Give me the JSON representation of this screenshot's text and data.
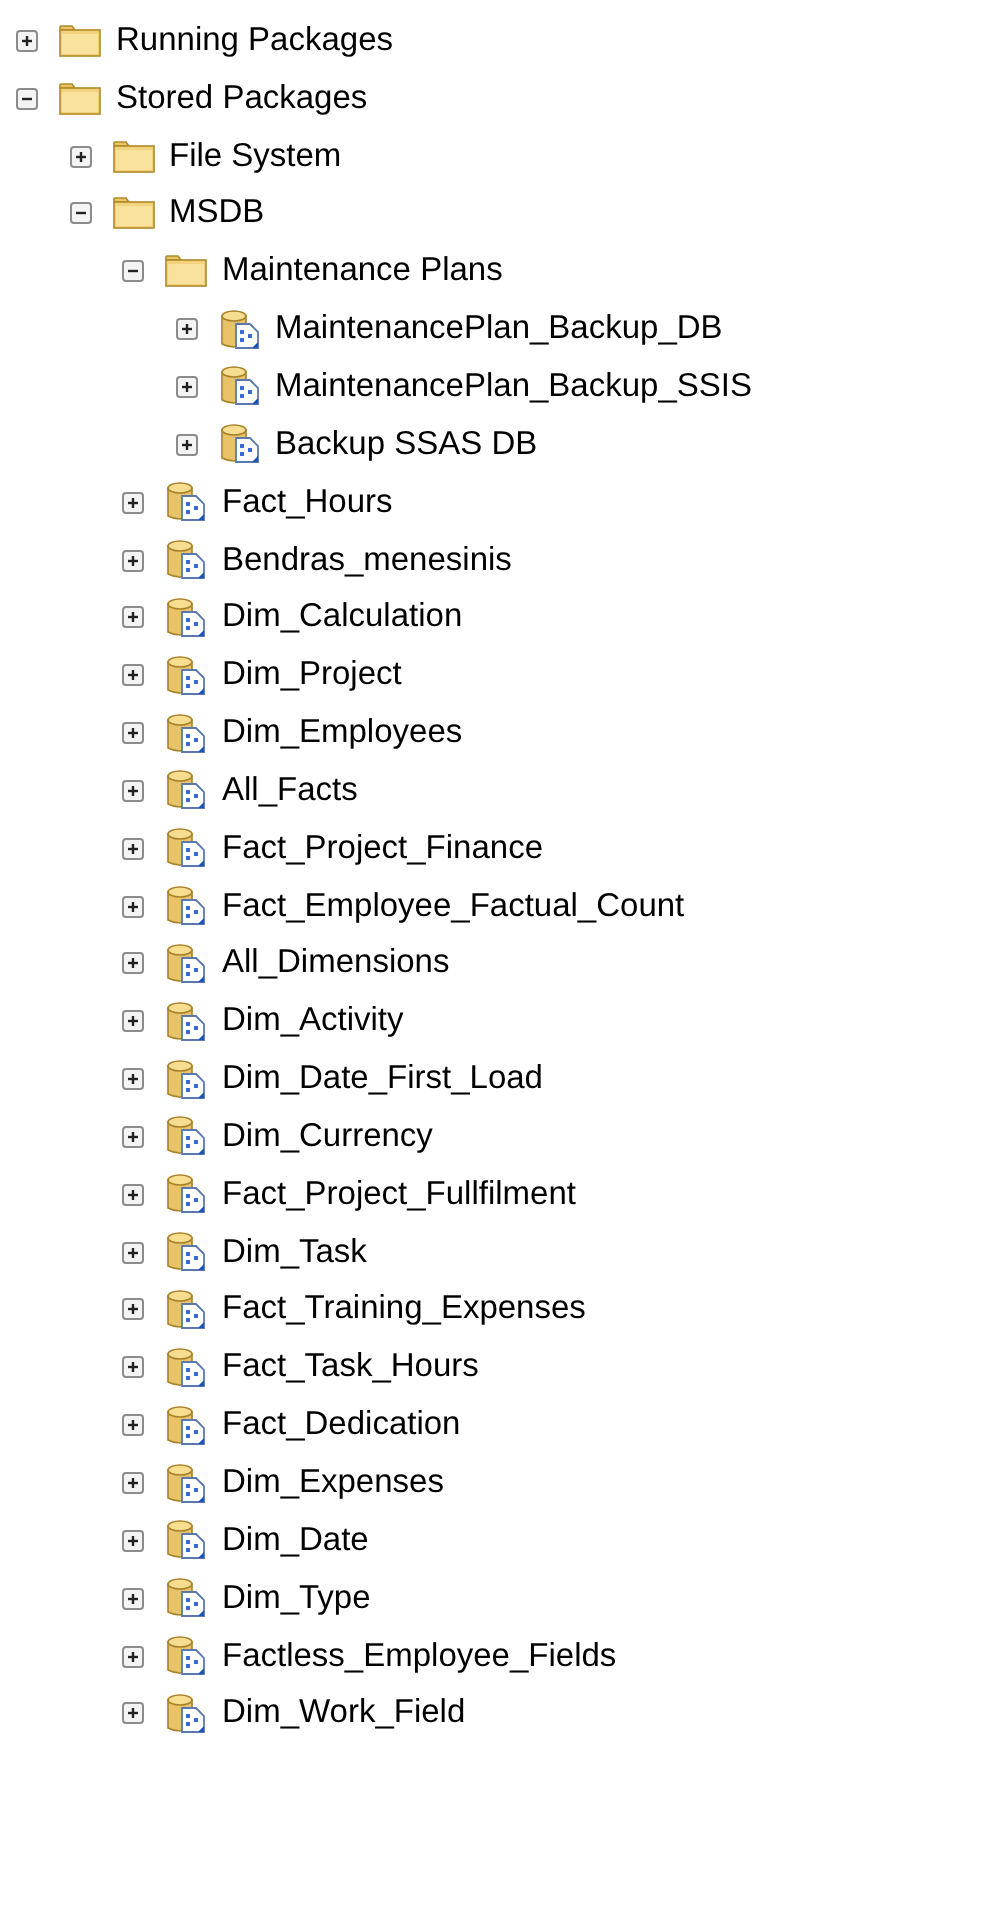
{
  "tree": [
    {
      "label": "Running Packages",
      "kind": "folder",
      "expanded": false
    },
    {
      "label": "Stored Packages",
      "kind": "folder",
      "expanded": true,
      "children": [
        {
          "label": "File System",
          "kind": "folder",
          "expanded": false
        },
        {
          "label": "MSDB",
          "kind": "folder",
          "expanded": true,
          "children": [
            {
              "label": "Maintenance Plans",
              "kind": "folder",
              "expanded": true,
              "children": [
                {
                  "label": "MaintenancePlan_Backup_DB",
                  "kind": "package",
                  "expanded": false
                },
                {
                  "label": "MaintenancePlan_Backup_SSIS",
                  "kind": "package",
                  "expanded": false
                },
                {
                  "label": "Backup SSAS DB",
                  "kind": "package",
                  "expanded": false
                }
              ]
            },
            {
              "label": "Fact_Hours",
              "kind": "package",
              "expanded": false
            },
            {
              "label": "Bendras_menesinis",
              "kind": "package",
              "expanded": false
            },
            {
              "label": "Dim_Calculation",
              "kind": "package",
              "expanded": false
            },
            {
              "label": "Dim_Project",
              "kind": "package",
              "expanded": false
            },
            {
              "label": "Dim_Employees",
              "kind": "package",
              "expanded": false
            },
            {
              "label": "All_Facts",
              "kind": "package",
              "expanded": false
            },
            {
              "label": "Fact_Project_Finance",
              "kind": "package",
              "expanded": false
            },
            {
              "label": "Fact_Employee_Factual_Count",
              "kind": "package",
              "expanded": false
            },
            {
              "label": "All_Dimensions",
              "kind": "package",
              "expanded": false
            },
            {
              "label": "Dim_Activity",
              "kind": "package",
              "expanded": false
            },
            {
              "label": "Dim_Date_First_Load",
              "kind": "package",
              "expanded": false
            },
            {
              "label": "Dim_Currency",
              "kind": "package",
              "expanded": false
            },
            {
              "label": "Fact_Project_Fullfilment",
              "kind": "package",
              "expanded": false
            },
            {
              "label": "Dim_Task",
              "kind": "package",
              "expanded": false
            },
            {
              "label": "Fact_Training_Expenses",
              "kind": "package",
              "expanded": false
            },
            {
              "label": "Fact_Task_Hours",
              "kind": "package",
              "expanded": false
            },
            {
              "label": "Fact_Dedication",
              "kind": "package",
              "expanded": false
            },
            {
              "label": "Dim_Expenses",
              "kind": "package",
              "expanded": false
            },
            {
              "label": "Dim_Date",
              "kind": "package",
              "expanded": false
            },
            {
              "label": "Dim_Type",
              "kind": "package",
              "expanded": false
            },
            {
              "label": "Factless_Employee_Fields",
              "kind": "package",
              "expanded": false
            },
            {
              "label": "Dim_Work_Field",
              "kind": "package",
              "expanded": false
            }
          ]
        }
      ]
    }
  ]
}
